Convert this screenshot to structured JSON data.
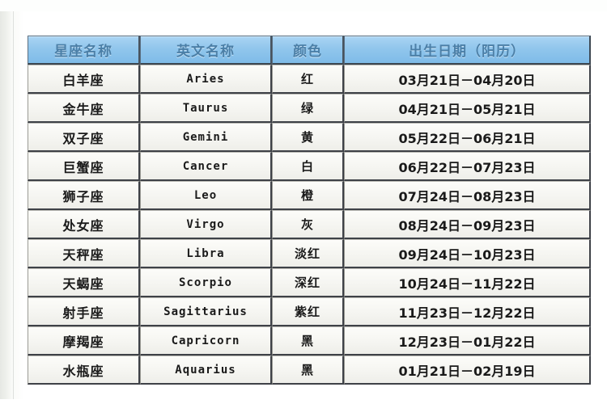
{
  "document": {
    "top_cropped_text": "· · ·  · ·  · · ·",
    "background_color": "#ffffff",
    "header_color": "#8fc5ec",
    "header_text_color": "#4a7fa8",
    "cell_color": "#f4f4f0",
    "border_color": "#3f4248"
  },
  "table": {
    "columns": [
      {
        "key": "name_cn",
        "label": "星座名称"
      },
      {
        "key": "name_en",
        "label": "英文名称"
      },
      {
        "key": "color",
        "label": "颜色"
      },
      {
        "key": "birthdate",
        "label": "出生日期（阳历）"
      }
    ],
    "rows": [
      {
        "name_cn": "白羊座",
        "name_en": "Aries",
        "color": "红",
        "birthdate": "03月21日－04月20日"
      },
      {
        "name_cn": "金牛座",
        "name_en": "Taurus",
        "color": "绿",
        "birthdate": "04月21日－05月21日"
      },
      {
        "name_cn": "双子座",
        "name_en": "Gemini",
        "color": "黄",
        "birthdate": "05月22日－06月21日"
      },
      {
        "name_cn": "巨蟹座",
        "name_en": "Cancer",
        "color": "白",
        "birthdate": "06月22日－07月23日"
      },
      {
        "name_cn": "狮子座",
        "name_en": "Leo",
        "color": "橙",
        "birthdate": "07月24日－08月23日"
      },
      {
        "name_cn": "处女座",
        "name_en": "Virgo",
        "color": "灰",
        "birthdate": "08月24日－09月23日"
      },
      {
        "name_cn": "天秤座",
        "name_en": "Libra",
        "color": "淡红",
        "birthdate": "09月24日－10月23日"
      },
      {
        "name_cn": "天蝎座",
        "name_en": "Scorpio",
        "color": "深红",
        "birthdate": "10月24日－11月22日"
      },
      {
        "name_cn": "射手座",
        "name_en": "Sagittarius",
        "color": "紫红",
        "birthdate": "11月23日－12月22日"
      },
      {
        "name_cn": "摩羯座",
        "name_en": "Capricorn",
        "color": "黑",
        "birthdate": "12月23日－01月22日"
      },
      {
        "name_cn": "水瓶座",
        "name_en": "Aquarius",
        "color": "黑",
        "birthdate": "01月21日－02月19日"
      }
    ]
  }
}
